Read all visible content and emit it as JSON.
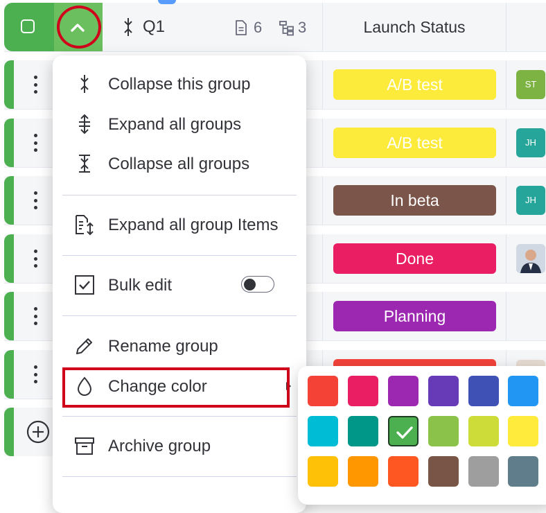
{
  "header": {
    "group_name": "Q1",
    "item_count": "6",
    "subitem_count": "3",
    "status_column_title": "Launch Status"
  },
  "rows": [
    {
      "status": "A/B test",
      "status_color": "#fdeb3b",
      "avatar": "ST",
      "avatar_color": "#7cb342"
    },
    {
      "status": "A/B test",
      "status_color": "#fdeb3b",
      "avatar": "JH",
      "avatar_color": "#26a69a"
    },
    {
      "status": "In beta",
      "status_color": "#7b5549",
      "avatar": "JH",
      "avatar_color": "#26a69a"
    },
    {
      "status": "Done",
      "status_color": "#e91e63",
      "avatar": "",
      "avatar_color": "photo"
    },
    {
      "status": "Planning",
      "status_color": "#9c27b0",
      "avatar": "",
      "avatar_color": ""
    },
    {
      "status": "",
      "status_color": "#f4433a",
      "avatar": "",
      "avatar_color": "photo"
    }
  ],
  "menu": {
    "items": [
      {
        "label": "Collapse this group",
        "icon": "collapse-this-icon"
      },
      {
        "label": "Expand all groups",
        "icon": "expand-all-icon"
      },
      {
        "label": "Collapse all groups",
        "icon": "collapse-all-icon"
      },
      {
        "label": "Expand all group Items",
        "icon": "expand-items-icon"
      },
      {
        "label": "Bulk edit",
        "icon": "checkbox-icon"
      },
      {
        "label": "Rename group",
        "icon": "pencil-icon"
      },
      {
        "label": "Change color",
        "icon": "drop-icon"
      },
      {
        "label": "Archive group",
        "icon": "archive-icon"
      }
    ],
    "bulk_edit_toggle": "off"
  },
  "palette": {
    "colors": [
      "#f44336",
      "#e91e63",
      "#9c27b0",
      "#673ab7",
      "#3f51b5",
      "#2196f3",
      "#00bcd4",
      "#009688",
      "#4caf50",
      "#8bc34a",
      "#cddc39",
      "#ffeb3b",
      "#ffc107",
      "#ff9800",
      "#ff5722",
      "#795548",
      "#9e9e9e",
      "#607d8b"
    ],
    "selected": "#4caf50"
  },
  "colors": {
    "group_green": "#4caf50",
    "highlight_red": "#d0021b"
  }
}
